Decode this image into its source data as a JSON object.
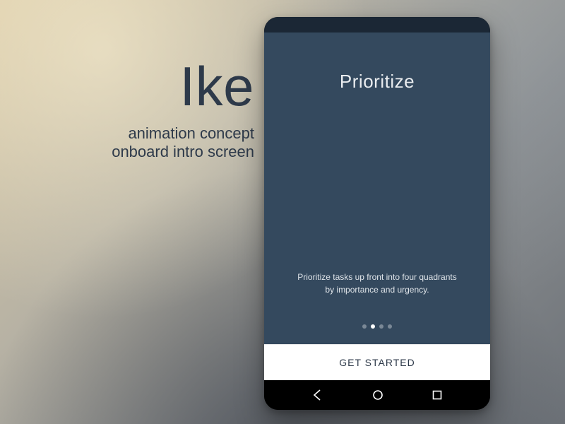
{
  "caption": {
    "title": "Ike",
    "line1": "animation concept",
    "line2": "onboard intro screen"
  },
  "onboard": {
    "heading": "Prioritize",
    "body": "Prioritize tasks up front into four quadrants by importance and urgency.",
    "page_count": 4,
    "active_page_index": 1,
    "cta_label": "GET STARTED"
  },
  "colors": {
    "phone_bg": "#34495e",
    "cta_bg": "#ffffff",
    "text_dark": "#2e3a4a"
  }
}
